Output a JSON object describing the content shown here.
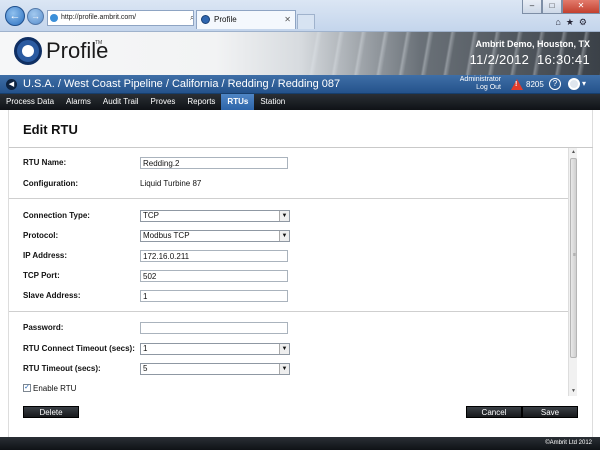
{
  "browser": {
    "address": "http://profile.ambrit.com/",
    "address_tools": "⌕ ▾ ⊠ ↻ ✕",
    "tab_title": "Profile",
    "tab_close": "✕",
    "back_glyph": "←",
    "forward_glyph": "→",
    "min_glyph": "–",
    "max_glyph": "□",
    "close_glyph": "✕",
    "tool_glyphs": "⌂★⚙"
  },
  "app": {
    "logo_text": "Profile",
    "logo_tm": "TM",
    "company": "Ambrit Demo, Houston, TX",
    "date": "11/2/2012",
    "time": "16:30:41"
  },
  "breadcrumb": {
    "back_glyph": "◀",
    "path": "U.S.A. / West Coast Pipeline / California / Redding / Redding 087",
    "user": "Administrator",
    "logout": "Log Out",
    "alarm_count": "8205",
    "help_glyph": "?",
    "settings_caret": "▾"
  },
  "nav": {
    "tabs": [
      {
        "label": "Process Data",
        "active": false
      },
      {
        "label": "Alarms",
        "active": false
      },
      {
        "label": "Audit Trail",
        "active": false
      },
      {
        "label": "Proves",
        "active": false
      },
      {
        "label": "Reports",
        "active": false
      },
      {
        "label": "RTUs",
        "active": true
      },
      {
        "label": "Station",
        "active": false
      }
    ]
  },
  "form": {
    "title": "Edit RTU",
    "rtu_name_label": "RTU Name:",
    "rtu_name_value": "Redding.2",
    "configuration_label": "Configuration:",
    "configuration_value": "Liquid Turbine 87",
    "connection_type_label": "Connection Type:",
    "connection_type_value": "TCP",
    "protocol_label": "Protocol:",
    "protocol_value": "Modbus TCP",
    "ip_label": "IP Address:",
    "ip_value": "172.16.0.211",
    "tcp_port_label": "TCP Port:",
    "tcp_port_value": "502",
    "slave_label": "Slave Address:",
    "slave_value": "1",
    "password_label": "Password:",
    "password_value": "",
    "connect_timeout_label": "RTU Connect Timeout (secs):",
    "connect_timeout_value": "1",
    "timeout_label": "RTU Timeout (secs):",
    "timeout_value": "5",
    "enable_label": "Enable RTU",
    "enable_checked": true,
    "check_glyph": "✓",
    "select_arrow": "▼"
  },
  "scrollbar": {
    "up_glyph": "▲",
    "down_glyph": "▼",
    "grip_glyph": "≡"
  },
  "actions": {
    "delete_label": "Delete",
    "cancel_label": "Cancel",
    "save_label": "Save"
  },
  "footer": {
    "copyright": "©Ambrit Ltd 2012"
  }
}
